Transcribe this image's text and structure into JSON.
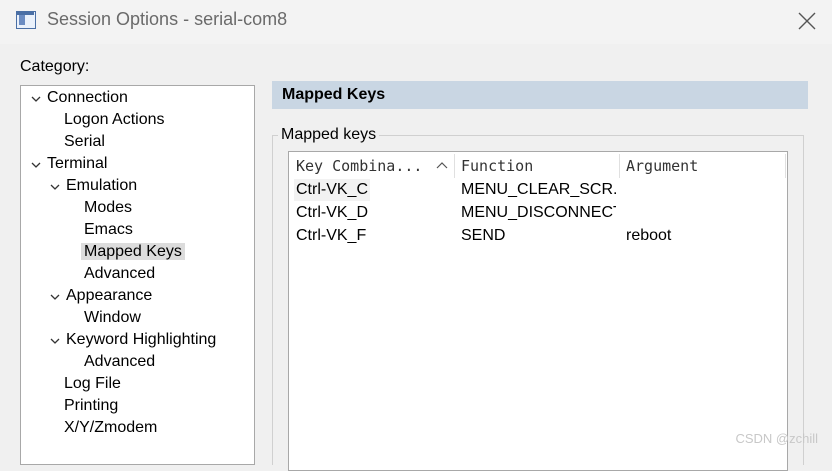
{
  "window": {
    "title": "Session Options - serial-com8",
    "close_icon": "close-icon"
  },
  "category": {
    "label": "Category:",
    "tree": [
      {
        "label": "Connection",
        "expanded": true
      },
      {
        "label": "Logon Actions"
      },
      {
        "label": "Serial"
      },
      {
        "label": "Terminal",
        "expanded": true
      },
      {
        "label": "Emulation",
        "expanded": true
      },
      {
        "label": "Modes"
      },
      {
        "label": "Emacs"
      },
      {
        "label": "Mapped Keys",
        "selected": true
      },
      {
        "label": "Advanced"
      },
      {
        "label": "Appearance",
        "expanded": true
      },
      {
        "label": "Window"
      },
      {
        "label": "Keyword Highlighting",
        "expanded": true
      },
      {
        "label": "Advanced"
      },
      {
        "label": "Log File"
      },
      {
        "label": "Printing"
      },
      {
        "label": "X/Y/Zmodem"
      }
    ]
  },
  "panel": {
    "header": "Mapped Keys",
    "group_label": "Mapped keys",
    "columns": [
      "Key Combina...",
      "Function",
      "Argument"
    ],
    "rows": [
      {
        "key": "Ctrl-VK_C",
        "function": "MENU_CLEAR_SCR...",
        "argument": ""
      },
      {
        "key": "Ctrl-VK_D",
        "function": "MENU_DISCONNECT",
        "argument": ""
      },
      {
        "key": "Ctrl-VK_F",
        "function": "SEND",
        "argument": "reboot"
      }
    ]
  },
  "watermark": "CSDN @zchill",
  "colors": {
    "section_header_bg": "#c9d6e3",
    "selected_item_bg": "#dcdcdc"
  }
}
